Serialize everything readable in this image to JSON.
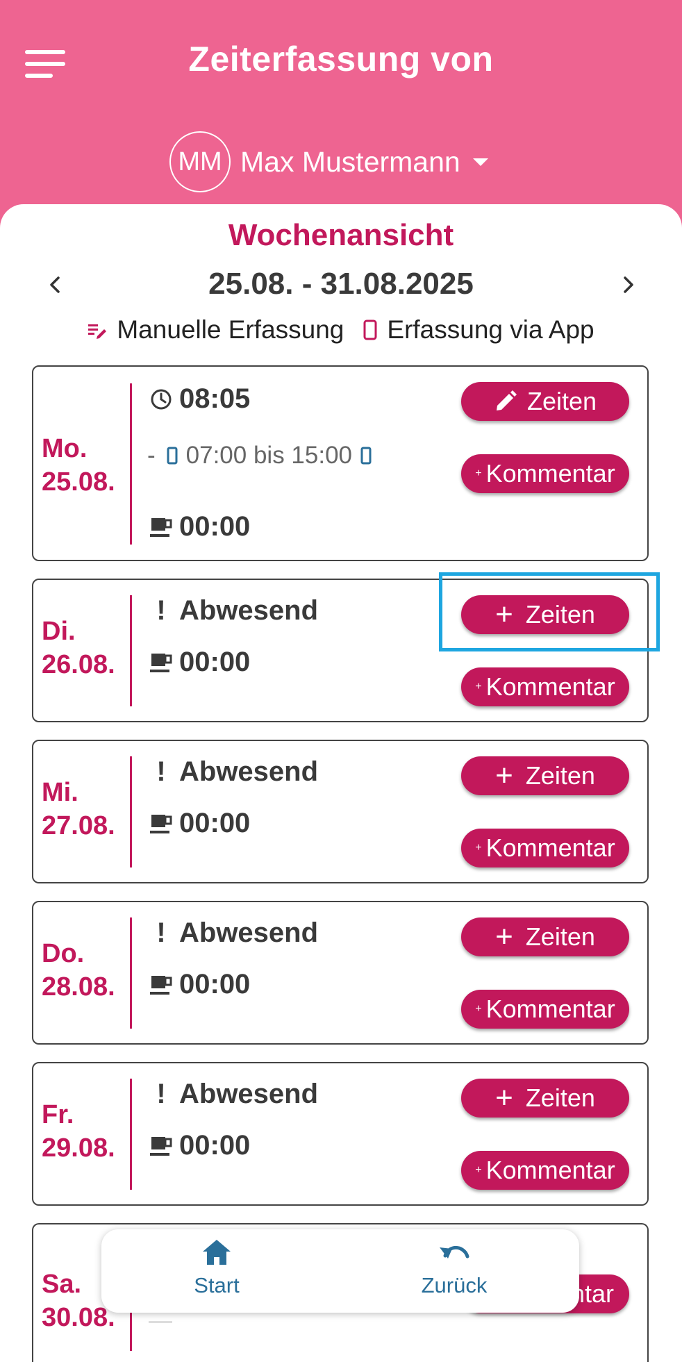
{
  "header": {
    "title": "Zeiterfassung von",
    "user_initials": "MM",
    "user_name": "Max Mustermann",
    "background_color": "#ee6491"
  },
  "week": {
    "title": "Wochenansicht",
    "range": "25.08. - 31.08.2025",
    "accent_color": "#c2185b"
  },
  "legend": {
    "manual_label": "Manuelle Erfassung",
    "app_label": "Erfassung via App"
  },
  "days": [
    {
      "day_name": "Mo.",
      "date": "25.08.",
      "work_time": "08:05",
      "interval_dash": "-",
      "interval": "07:00 bis 15:00",
      "break_time": "00:00",
      "times_label": "Zeiten",
      "comment_label": "Kommentar",
      "plus_small": "+"
    },
    {
      "day_name": "Di.",
      "date": "26.08.",
      "status_mark": "!",
      "status": "Abwesend",
      "break_time": "00:00",
      "add_symbol": "+",
      "times_label": "Zeiten",
      "comment_label": "Kommentar",
      "plus_small": "+"
    },
    {
      "day_name": "Mi.",
      "date": "27.08.",
      "status_mark": "!",
      "status": "Abwesend",
      "break_time": "00:00",
      "add_symbol": "+",
      "times_label": "Zeiten",
      "comment_label": "Kommentar",
      "plus_small": "+"
    },
    {
      "day_name": "Do.",
      "date": "28.08.",
      "status_mark": "!",
      "status": "Abwesend",
      "break_time": "00:00",
      "add_symbol": "+",
      "times_label": "Zeiten",
      "comment_label": "Kommentar",
      "plus_small": "+"
    },
    {
      "day_name": "Fr.",
      "date": "29.08.",
      "status_mark": "!",
      "status": "Abwesend",
      "break_time": "00:00",
      "add_symbol": "+",
      "times_label": "Zeiten",
      "comment_label": "Kommentar",
      "plus_small": "+"
    },
    {
      "day_name": "Sa.",
      "date": "30.08.",
      "comment_label_partial": "ntar"
    }
  ],
  "bottom_nav": {
    "start_label": "Start",
    "back_label": "Zurück",
    "icon_color": "#2a6f9a"
  }
}
